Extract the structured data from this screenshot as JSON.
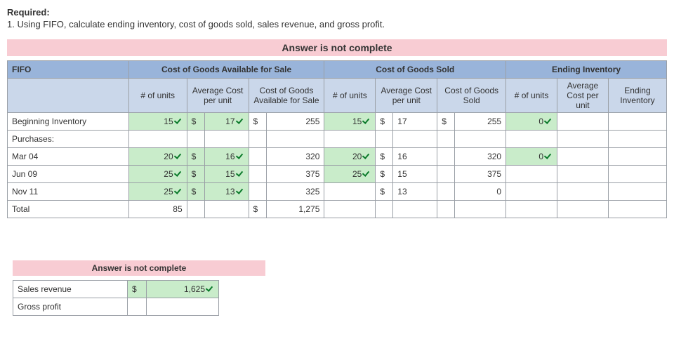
{
  "required_label": "Required:",
  "required_text": "1. Using FIFO, calculate ending inventory, cost of goods sold, sales revenue, and gross profit.",
  "banner_main": "Answer is not complete",
  "headers": {
    "fifo": "FIFO",
    "cogas": "Cost of Goods Available for Sale",
    "cogs": "Cost of Goods Sold",
    "ending": "Ending Inventory",
    "units": "# of units",
    "avg": "Average Cost per unit",
    "cogas_col": "Cost of Goods Available for Sale",
    "cogs_col": "Cost of Goods Sold",
    "ending_col": "Ending Inventory"
  },
  "rows": {
    "beg": {
      "label": "Beginning Inventory",
      "units_a": "15",
      "avg_a": "17",
      "amt_a": "255",
      "units_b": "15",
      "avg_b": "17",
      "amt_b": "255",
      "units_c": "0"
    },
    "purchases": "Purchases:",
    "mar": {
      "label": "Mar 04",
      "units_a": "20",
      "avg_a": "16",
      "amt_a": "320",
      "units_b": "20",
      "avg_b": "16",
      "amt_b": "320",
      "units_c": "0"
    },
    "jun": {
      "label": "Jun 09",
      "units_a": "25",
      "avg_a": "15",
      "amt_a": "375",
      "units_b": "25",
      "avg_b": "15",
      "amt_b": "375"
    },
    "nov": {
      "label": "Nov 11",
      "units_a": "25",
      "avg_a": "13",
      "amt_a": "325",
      "avg_b": "13",
      "amt_b": "0"
    },
    "total": {
      "label": "Total",
      "units_a": "85",
      "amt_a": "1,275"
    }
  },
  "dollar": "$",
  "banner_small": "Answer is not complete",
  "small": {
    "sales_label": "Sales revenue",
    "sales_value": "1,625",
    "gross_label": "Gross profit"
  }
}
